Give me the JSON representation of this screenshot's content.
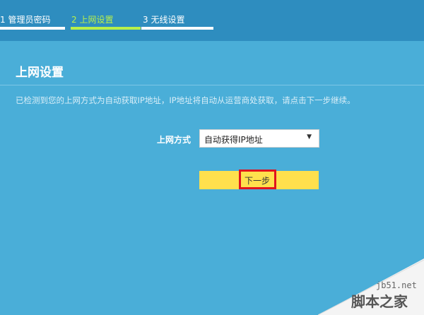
{
  "steps": [
    {
      "label": "1 管理员密码",
      "active": false
    },
    {
      "label": "2 上网设置",
      "active": true
    },
    {
      "label": "3 无线设置",
      "active": false
    }
  ],
  "page": {
    "title": "上网设置",
    "description": "已检测到您的上网方式为自动获取IP地址，IP地址将自动从运营商处获取，请点击下一步继续。"
  },
  "form": {
    "connection_label": "上网方式",
    "connection_value": "自动获得IP地址"
  },
  "actions": {
    "next_label": "下一步"
  },
  "watermark": {
    "site": "jb51.net",
    "name": "脚本之家"
  },
  "colors": {
    "background": "#4aaed8",
    "topbar": "#2e8dbf",
    "active_step": "#b8f04a",
    "next_button": "#ffe04d",
    "highlight_box": "#e0141e"
  }
}
